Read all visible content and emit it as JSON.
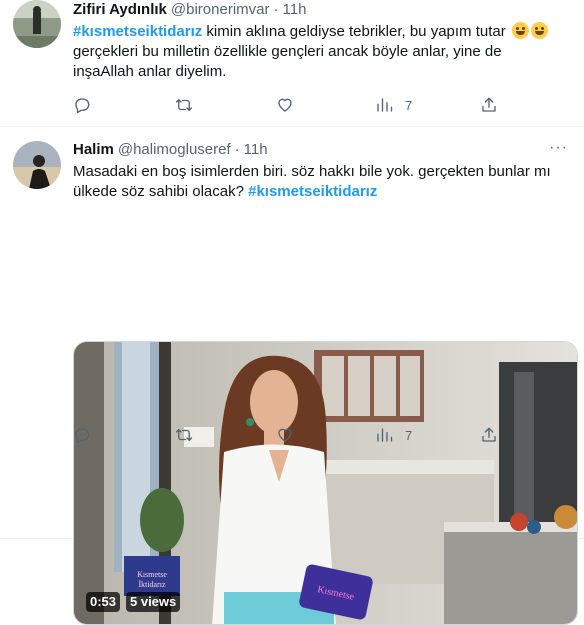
{
  "tweets": [
    {
      "name": "Zifiri Aydınlık",
      "handle": "@bironerimvar",
      "dot": "·",
      "time": "11h",
      "text": {
        "hashtag": "#kısmetseiktidarız",
        "rest": " kimin aklına geldiyse tebrikler, bu yapım tutar ",
        "line2": "gerçekleri bu milletin özellikle gençleri ancak böyle anlar, yine de",
        "line3": "inşaAllah anlar diyelim."
      },
      "emojis": [
        "grinning-face",
        "grinning-face"
      ],
      "actions": {
        "replies": "",
        "retweets": "",
        "likes": "",
        "views": "7"
      }
    },
    {
      "name": "Halim",
      "handle": "@halimogluseref",
      "dot": "·",
      "time": "11h",
      "more": "···",
      "text": {
        "line1": "Masadaki en boş isimlerden biri. söz hakkı bile yok. gerçekten bunlar mı",
        "line2_pre": "ülkede söz sahibi olacak? ",
        "hashtag": "#kısmetseiktidarız"
      },
      "media": {
        "duration": "0:53",
        "views": "5 views",
        "logo_text": "Kısmetse İktidarız",
        "card_text": "Kısmetse İktidarız"
      },
      "actions": {
        "replies": "",
        "retweets": "",
        "likes": "",
        "views": "7"
      }
    }
  ]
}
